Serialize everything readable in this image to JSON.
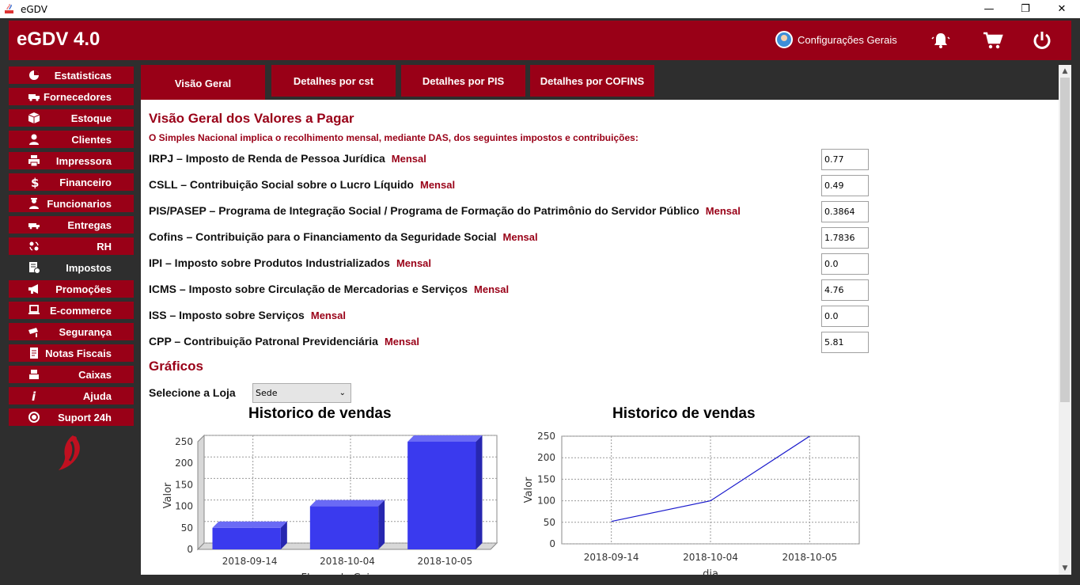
{
  "window": {
    "title": "eGDV",
    "minimize": "—",
    "maximize": "❐",
    "close": "✕"
  },
  "header": {
    "brand": "eGDV 4.0",
    "settings_label": "Configurações Gerais"
  },
  "sidebar": {
    "items": [
      {
        "label": "Estatisticas",
        "icon": "chart-icon"
      },
      {
        "label": "Fornecedores",
        "icon": "truck-icon"
      },
      {
        "label": "Estoque",
        "icon": "box-icon"
      },
      {
        "label": "Clientes",
        "icon": "user-icon"
      },
      {
        "label": "Impressora",
        "icon": "printer-icon"
      },
      {
        "label": "Financeiro",
        "icon": "dollar-icon"
      },
      {
        "label": "Funcionarios",
        "icon": "worker-icon"
      },
      {
        "label": "Entregas",
        "icon": "delivery-icon"
      },
      {
        "label": "RH",
        "icon": "hr-icon"
      },
      {
        "label": "Impostos",
        "icon": "tax-icon"
      },
      {
        "label": "Promoções",
        "icon": "megaphone-icon"
      },
      {
        "label": "E-commerce",
        "icon": "laptop-icon"
      },
      {
        "label": "Segurança",
        "icon": "camera-icon"
      },
      {
        "label": "Notas Fiscais",
        "icon": "document-icon"
      },
      {
        "label": "Caixas",
        "icon": "register-icon"
      },
      {
        "label": "Ajuda",
        "icon": "info-icon"
      },
      {
        "label": "Suport 24h",
        "icon": "support-icon"
      }
    ],
    "active_index": 9
  },
  "tabs": [
    {
      "label": "Visão Geral",
      "active": true
    },
    {
      "label": "Detalhes por cst",
      "active": false
    },
    {
      "label": "Detalhes por PIS",
      "active": false
    },
    {
      "label": "Detalhes por COFINS",
      "active": false
    }
  ],
  "main": {
    "title": "Visão Geral dos Valores a Pagar",
    "subtitle": "O Simples Nacional implica o recolhimento mensal, mediante DAS, dos seguintes impostos e contribuições:",
    "taxes": [
      {
        "name": "IRPJ – Imposto de Renda de Pessoa Jurídica",
        "freq": "Mensal",
        "value": "0.77"
      },
      {
        "name": "CSLL – Contribuição Social sobre o Lucro Líquido",
        "freq": "Mensal",
        "value": "0.49"
      },
      {
        "name": "PIS/PASEP – Programa de Integração Social / Programa de Formação do Patrimônio do Servidor Público",
        "freq": "Mensal",
        "value": "0.3864"
      },
      {
        "name": "Cofins – Contribuição para o Financiamento da Seguridade Social",
        "freq": "Mensal",
        "value": "1.7836"
      },
      {
        "name": "IPI – Imposto sobre Produtos Industrializados",
        "freq": "Mensal",
        "value": "0.0"
      },
      {
        "name": "ICMS – Imposto sobre Circulação de Mercadorias e Serviços",
        "freq": "Mensal",
        "value": "4.76"
      },
      {
        "name": "ISS – Imposto sobre Serviços ",
        "freq": "Mensal",
        "value": "0.0"
      },
      {
        "name": "CPP – Contribuição Patronal Previdenciária ",
        "freq": "Mensal",
        "value": "5.81"
      }
    ],
    "charts_heading": "Gráficos",
    "store_label": "Selecione a Loja",
    "store_value": "Sede"
  },
  "colors": {
    "brand": "#990017",
    "bar": "#3a3aee",
    "line": "#1a1acc"
  },
  "chart_data": [
    {
      "type": "bar",
      "title": "Historico de vendas",
      "xlabel": "Fluxos de Caixas",
      "ylabel": "Valor",
      "categories": [
        "2018-09-14",
        "2018-10-04",
        "2018-10-05"
      ],
      "values": [
        50,
        100,
        250
      ],
      "ylim": [
        0,
        250
      ],
      "yticks": [
        0,
        50,
        100,
        150,
        200,
        250
      ],
      "grid": true,
      "style": "3d"
    },
    {
      "type": "line",
      "title": "Historico de vendas",
      "xlabel": "dia",
      "ylabel": "Valor",
      "categories": [
        "2018-09-14",
        "2018-10-04",
        "2018-10-05"
      ],
      "values": [
        52,
        100,
        250
      ],
      "ylim": [
        0,
        250
      ],
      "yticks": [
        0,
        50,
        100,
        150,
        200,
        250
      ],
      "grid": true
    }
  ]
}
